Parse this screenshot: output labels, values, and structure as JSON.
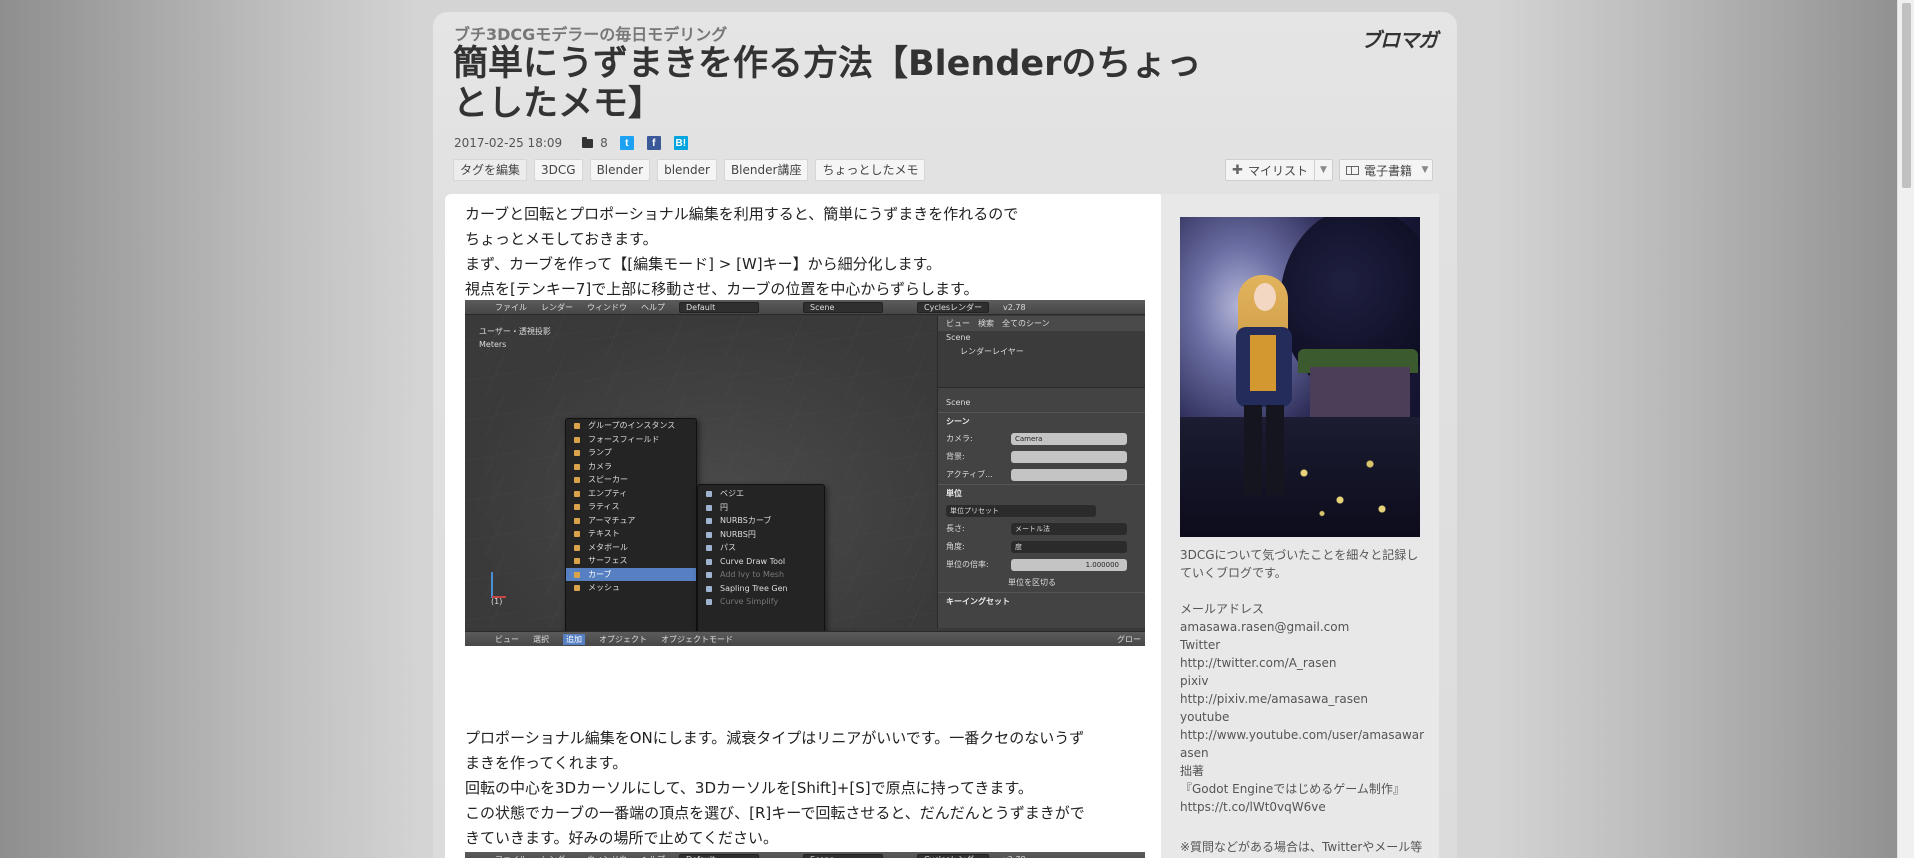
{
  "blog": {
    "name": "ブチ3DCGモデラーの毎日モデリング",
    "brand": "ブロマガ"
  },
  "article": {
    "title": "簡単にうずまきを作る方法【Blenderのちょっとしたメモ】",
    "date": "2017-02-25 18:09",
    "comment_count": "8",
    "share": {
      "twitter": "t",
      "facebook": "f",
      "hatena": "B!"
    },
    "tags": [
      "タグを編集",
      "3DCG",
      "Blender",
      "blender",
      "Blender講座",
      "ちょっとしたメモ"
    ],
    "mylist_label": "マイリスト",
    "ebook_label": "電子書籍",
    "paragraphs": [
      [
        "カーブと回転とプロポーショナル編集を利用すると、簡単にうずまきを作れるので",
        "ちょっとメモしておきます。"
      ],
      [
        "まず、カーブを作って【[編集モード] > [W]キー】から細分化します。",
        "視点を[テンキー7]で上部に移動させ、カーブの位置を中心からずらします。"
      ],
      [
        "プロポーショナル編集をONにします。減衰タイプはリニアがいいです。一番クセのないうず",
        "まきを作ってくれます。",
        "回転の中心を3Dカーソルにして、3Dカーソルを[Shift]+[S]で原点に持ってきます。",
        "この状態でカーブの一番端の頂点を選び、[R]キーで回転させると、だんだんとうずまきがで",
        "きていきます。好みの場所で止めてください。"
      ]
    ]
  },
  "blender_shot": {
    "top_menu": [
      "ファイル",
      "レンダー",
      "ウィンドウ",
      "ヘルプ"
    ],
    "layout": "Default",
    "scene": "Scene",
    "engine": "Cyclesレンダー",
    "version": "v2.78",
    "viewport_label": "ユーザー・透視投影",
    "units_label": "Meters",
    "frame": "(1)",
    "add_menu": [
      "グループのインスタンス",
      "フォースフィールド",
      "ランプ",
      "カメラ",
      "スピーカー",
      "エンプティ",
      "ラティス",
      "アーマチュア",
      "テキスト",
      "メタボール",
      "サーフェス",
      "カーブ",
      "メッシュ"
    ],
    "curve_menu": [
      "ベジエ",
      "円",
      "NURBSカーブ",
      "NURBS円",
      "パス",
      "Curve Draw Tool",
      "Add Ivy to Mesh",
      "Sapling Tree Gen",
      "Curve Simplify"
    ],
    "outliner": {
      "header": [
        "ビュー",
        "検索",
        "全てのシーン"
      ],
      "scene_item": "Scene",
      "layer_item": "レンダーレイヤー"
    },
    "props": {
      "scene_label": "Scene",
      "section_scene": "シーン",
      "camera_label": "カメラ:",
      "camera_value": "Camera",
      "background_label": "背景:",
      "active_label": "アクティブ...",
      "section_units": "単位",
      "unit_preset": "単位プリセット",
      "length_label": "長さ:",
      "length_value": "メートル法",
      "angle_label": "角度:",
      "angle_value": "度",
      "scale_label": "単位の倍率:",
      "scale_value": "1.000000",
      "separate_label": "単位を区切る",
      "section_keying": "キーイングセット"
    },
    "bottom_bar": [
      "ビュー",
      "選択",
      "追加",
      "オブジェクト",
      "オブジェクトモード",
      "グロー"
    ]
  },
  "sidebar": {
    "description": "3DCGについて気づいたことを細々と記録していくブログです。",
    "lines": [
      "メールアドレス",
      "amasawa.rasen@gmail.com",
      "Twitter",
      "http://twitter.com/A_rasen",
      "pixiv",
      "http://pixiv.me/amasawa_rasen",
      "youtube",
      "http://www.youtube.com/user/amasawarasen",
      "拙著",
      "『Godot Engineではじめるゲーム制作』",
      "https://t.co/lWt0vqW6ve"
    ],
    "note": "※質問などがある場合は、Twitterやメール等で知らせていただけると助かります。"
  }
}
